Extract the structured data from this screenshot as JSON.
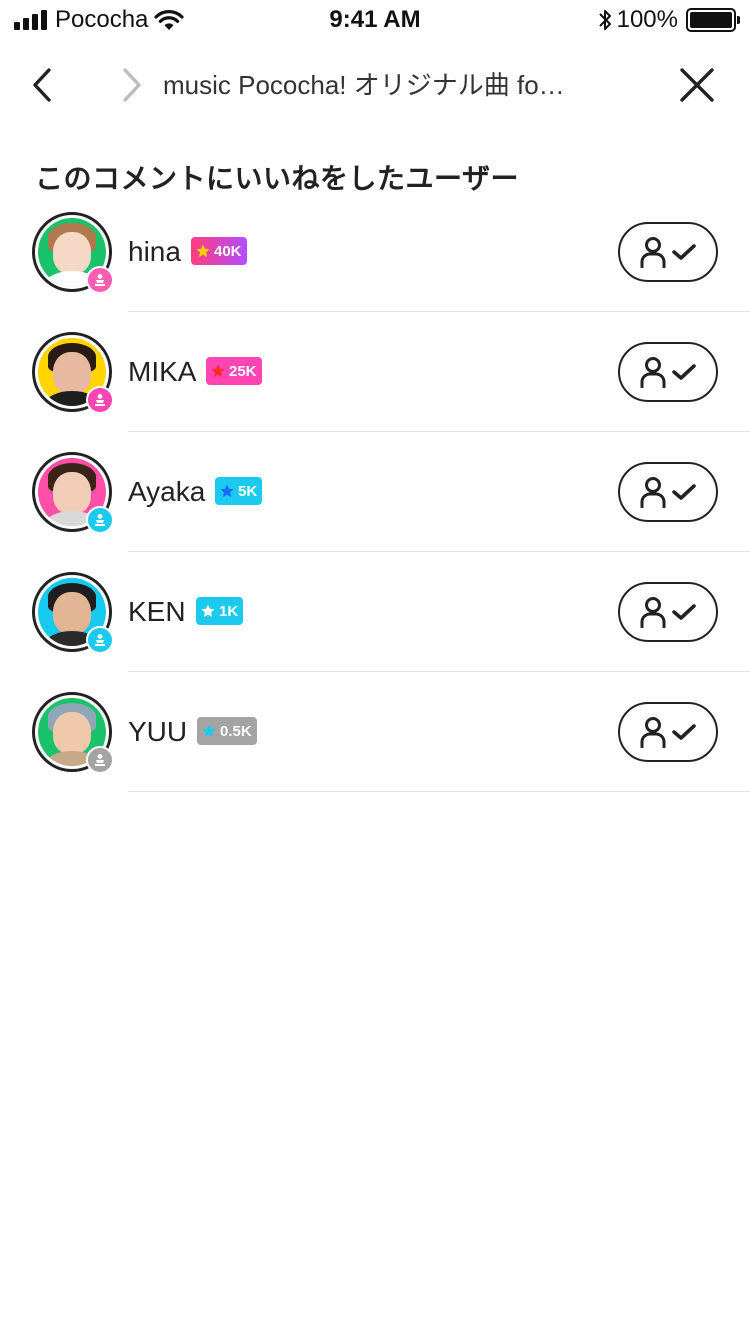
{
  "status_bar": {
    "carrier": "Pococha",
    "time": "9:41 AM",
    "battery": "100%",
    "battery_level": 1.0
  },
  "nav": {
    "title": "music Pococha! オリジナル曲 fo…",
    "back_icon": "chevron-left-icon",
    "forward_icon": "chevron-right-icon",
    "close_icon": "close-icon"
  },
  "section": {
    "title": "このコメントにいいねをしたユーザー"
  },
  "users": [
    {
      "name": "hina",
      "fans": "40K",
      "badge_color": "#ff3d7f",
      "badge_color2": "#b34dff",
      "star_color": "#ffcc00",
      "rank_color": "#ff5db1",
      "bg": "#19c26b",
      "hair": "#b07a4e",
      "skin": "#f6d8c6",
      "body": "#ffffff"
    },
    {
      "name": "MIKA",
      "fans": "25K",
      "badge_color": "#ff44b4",
      "badge_color2": "#ff44b4",
      "star_color": "#ff2a2a",
      "rank_color": "#ff44b4",
      "bg": "#ffd400",
      "hair": "#2a1a14",
      "skin": "#e8b9a0",
      "body": "#1f1f1f"
    },
    {
      "name": "Ayaka",
      "fans": "5K",
      "badge_color": "#1ccaf0",
      "badge_color2": "#1ccaf0",
      "star_color": "#1a6bff",
      "rank_color": "#1ccaf0",
      "bg": "#ff4fa8",
      "hair": "#3a2418",
      "skin": "#f1cdb7",
      "body": "#d9d9d9"
    },
    {
      "name": "KEN",
      "fans": "1K",
      "badge_color": "#1ccaf0",
      "badge_color2": "#1ccaf0",
      "star_color": "#ffffff",
      "rank_color": "#1ccaf0",
      "bg": "#17c9ee",
      "hair": "#1f1f1f",
      "skin": "#e2b695",
      "body": "#2b2b2b"
    },
    {
      "name": "YUU",
      "fans": "0.5K",
      "badge_color": "#a4a4a4",
      "badge_color2": "#a4a4a4",
      "star_color": "#1ccaf0",
      "rank_color": "#a4a4a4",
      "bg": "#19c26b",
      "hair": "#8fa6b6",
      "skin": "#f0c9ad",
      "body": "#c7a98a"
    }
  ],
  "follow_button": {
    "icon_user": "user-outline-icon",
    "icon_check": "checkmark-icon"
  }
}
